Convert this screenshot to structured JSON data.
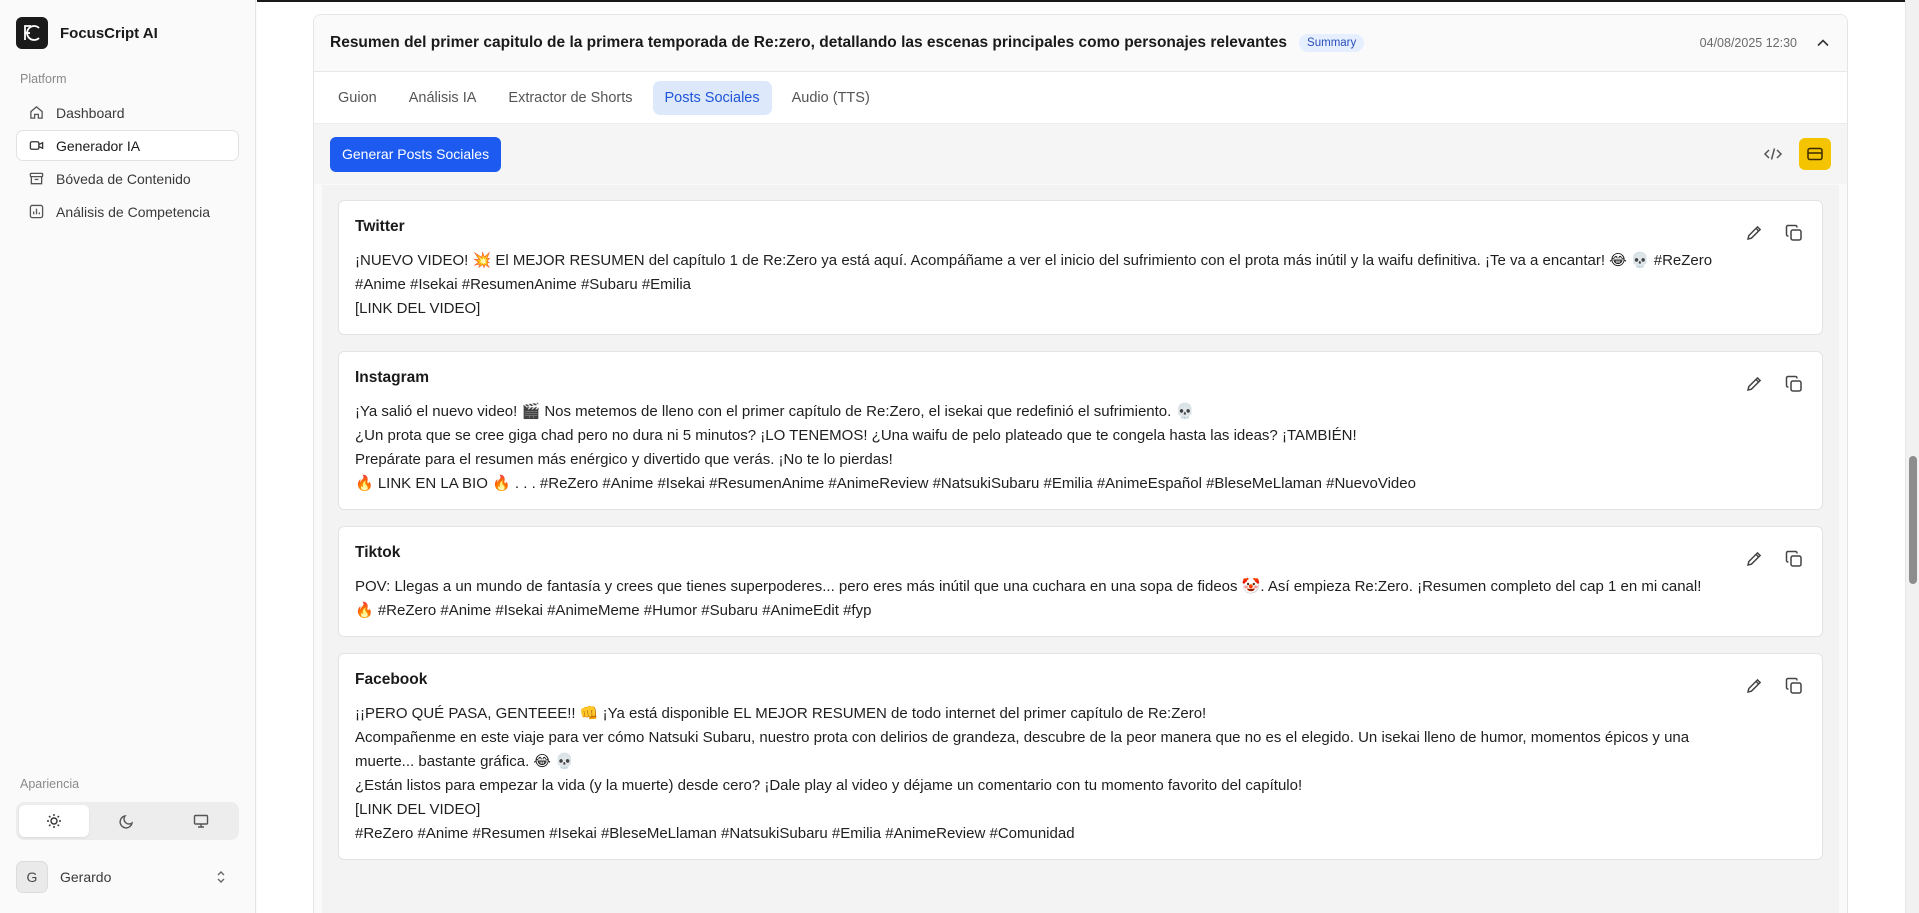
{
  "app": {
    "name": "FocusCript AI"
  },
  "sidebar": {
    "section_platform": "Platform",
    "items": [
      {
        "label": "Dashboard",
        "icon": "home-icon",
        "active": false
      },
      {
        "label": "Generador IA",
        "icon": "video-icon",
        "active": true
      },
      {
        "label": "Bóveda de Contenido",
        "icon": "archive-icon",
        "active": false
      },
      {
        "label": "Análisis de Competencia",
        "icon": "chart-icon",
        "active": false
      }
    ],
    "section_appearance": "Apariencia",
    "theme_options": [
      "sun-icon",
      "moon-icon",
      "monitor-icon"
    ],
    "theme_selected": "light",
    "user": {
      "initial": "G",
      "name": "Gerardo"
    }
  },
  "card": {
    "title": "Resumen del primer capitulo de la primera temporada de Re:zero, detallando las escenas principales como personajes relevantes",
    "badge": "Summary",
    "date": "04/08/2025 12:30"
  },
  "tabs": [
    {
      "label": "Guion",
      "active": false
    },
    {
      "label": "Análisis IA",
      "active": false
    },
    {
      "label": "Extractor de Shorts",
      "active": false
    },
    {
      "label": "Posts Sociales",
      "active": true
    },
    {
      "label": "Audio (TTS)",
      "active": false
    }
  ],
  "toolbar": {
    "generate_label": "Generar Posts Sociales"
  },
  "posts": [
    {
      "platform": "Twitter",
      "lines": [
        "¡NUEVO VIDEO! 💥 El MEJOR RESUMEN del capítulo 1 de Re:Zero ya está aquí. Acompáñame a ver el inicio del sufrimiento con el prota más inútil y la waifu definitiva. ¡Te va a encantar! 😂 💀 #ReZero",
        "#Anime #Isekai #ResumenAnime #Subaru #Emilia",
        "[LINK DEL VIDEO]"
      ]
    },
    {
      "platform": "Instagram",
      "lines": [
        "¡Ya salió el nuevo video! 🎬 Nos metemos de lleno con el primer capítulo de Re:Zero, el isekai que redefinió el sufrimiento. 💀",
        "¿Un prota que se cree giga chad pero no dura ni 5 minutos? ¡LO TENEMOS! ¿Una waifu de pelo plateado que te congela hasta las ideas? ¡TAMBIÉN!",
        "Prepárate para el resumen más enérgico y divertido que verás. ¡No te lo pierdas!",
        "🔥 LINK EN LA BIO 🔥 . . . #ReZero #Anime #Isekai #ResumenAnime #AnimeReview #NatsukiSubaru #Emilia #AnimeEspañol #BleseMeLlaman #NuevoVideo"
      ]
    },
    {
      "platform": "Tiktok",
      "lines": [
        "POV: Llegas a un mundo de fantasía y crees que tienes superpoderes... pero eres más inútil que una cuchara en una sopa de fideos 🤡. Así empieza Re:Zero. ¡Resumen completo del cap 1 en mi canal!",
        "🔥 #ReZero #Anime #Isekai #AnimeMeme #Humor #Subaru #AnimeEdit #fyp"
      ]
    },
    {
      "platform": "Facebook",
      "lines": [
        "¡¡PERO QUÉ PASA, GENTEEE!! 👊 ¡Ya está disponible EL MEJOR RESUMEN de todo internet del primer capítulo de Re:Zero!",
        "Acompañenme en este viaje para ver cómo Natsuki Subaru, nuestro prota con delirios de grandeza, descubre de la peor manera que no es el elegido. Un isekai lleno de humor, momentos épicos y una",
        "muerte... bastante gráfica. 😂 💀",
        "¿Están listos para empezar la vida (y la muerte) desde cero? ¡Dale play al video y déjame un comentario con tu momento favorito del capítulo!",
        "[LINK DEL VIDEO]",
        "#ReZero #Anime #Resumen #Isekai #BleseMeLlaman #NatsukiSubaru #Emilia #AnimeReview #Comunidad"
      ]
    }
  ]
}
